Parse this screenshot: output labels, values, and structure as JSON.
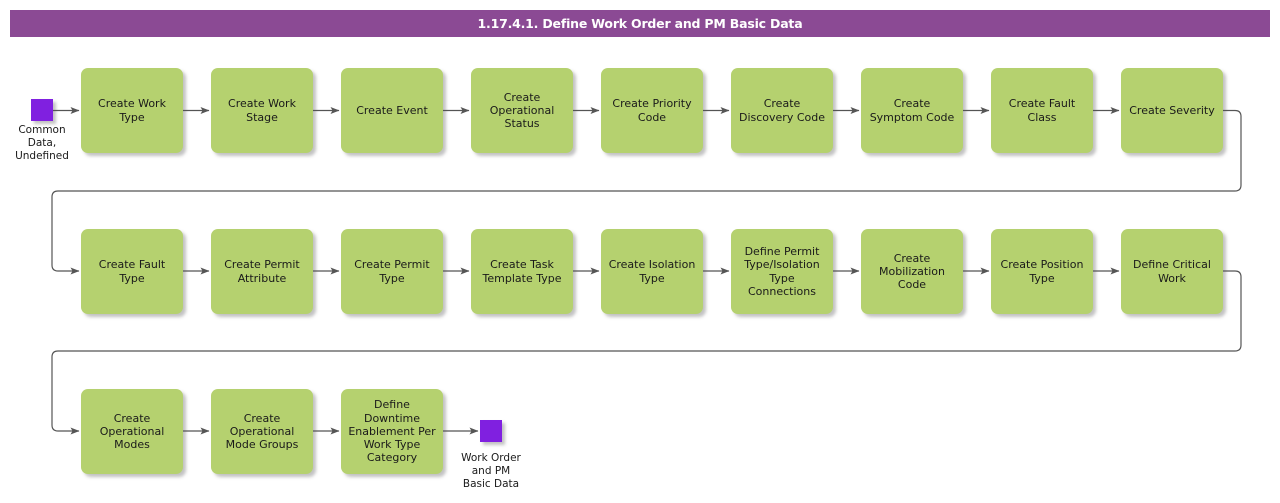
{
  "page": {
    "title": "1.17.4.1. Define Work Order and PM Basic Data",
    "background_color": "#ffffff"
  },
  "colors": {
    "header_purple": "#8b4a94",
    "node_green": "#b5d16f",
    "terminator_purple": "#8020e0",
    "connector_gray": "#555555",
    "text_dark": "#1a1a1a",
    "header_text": "#ffffff"
  },
  "start_terminator": {
    "name": "common-data-undefined",
    "label": "Common\nData,\nUndefined"
  },
  "end_terminator": {
    "name": "work-order-and-pm-basic-data",
    "label": "Work Order\nand PM\nBasic Data"
  },
  "rows": [
    {
      "index": 1,
      "nodes": [
        {
          "id": "create-work-type",
          "label": "Create Work\nType"
        },
        {
          "id": "create-work-stage",
          "label": "Create Work\nStage"
        },
        {
          "id": "create-event",
          "label": "Create Event"
        },
        {
          "id": "create-operational-status",
          "label": "Create\nOperational\nStatus"
        },
        {
          "id": "create-priority-code",
          "label": "Create Priority\nCode"
        },
        {
          "id": "create-discovery-code",
          "label": "Create\nDiscovery Code"
        },
        {
          "id": "create-symptom-code",
          "label": "Create\nSymptom Code"
        },
        {
          "id": "create-fault-class",
          "label": "Create Fault\nClass"
        },
        {
          "id": "create-severity",
          "label": "Create Severity"
        }
      ]
    },
    {
      "index": 2,
      "nodes": [
        {
          "id": "create-fault-type",
          "label": "Create Fault\nType"
        },
        {
          "id": "create-permit-attribute",
          "label": "Create Permit\nAttribute"
        },
        {
          "id": "create-permit-type",
          "label": "Create Permit\nType"
        },
        {
          "id": "create-task-template-type",
          "label": "Create Task\nTemplate Type"
        },
        {
          "id": "create-isolation-type",
          "label": "Create Isolation\nType"
        },
        {
          "id": "define-permit-type-isolation-type-connections",
          "label": "Define Permit\nType/Isolation\nType\nConnections"
        },
        {
          "id": "create-mobilization-code",
          "label": "Create\nMobilization\nCode"
        },
        {
          "id": "create-position-type",
          "label": "Create Position\nType"
        },
        {
          "id": "define-critical-work",
          "label": "Define Critical\nWork"
        }
      ]
    },
    {
      "index": 3,
      "nodes": [
        {
          "id": "create-operational-modes",
          "label": "Create\nOperational\nModes"
        },
        {
          "id": "create-operational-mode-groups",
          "label": "Create\nOperational\nMode Groups"
        },
        {
          "id": "define-downtime-enablement-per-work-type-category",
          "label": "Define\nDowntime\nEnablement Per\nWork Type\nCategory"
        }
      ]
    }
  ]
}
